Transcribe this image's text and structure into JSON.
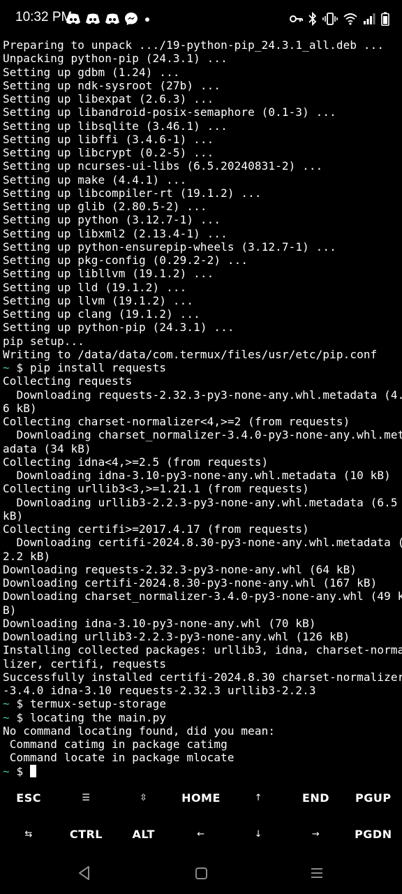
{
  "status_bar": {
    "time": "10:32 PM",
    "notification_icons": [
      "discord-icon",
      "discord-icon",
      "discord-icon",
      "messenger-icon",
      "dot-icon"
    ],
    "system_icons": [
      "key-icon",
      "bluetooth-icon",
      "vibrate-icon",
      "wifi-icon",
      "signal-icon",
      "battery-icon"
    ]
  },
  "terminal": {
    "prompt_symbol": "~",
    "lines": [
      "Preparing to unpack .../19-python-pip_24.3.1_all.deb ...",
      "Unpacking python-pip (24.3.1) ...",
      "Setting up gdbm (1.24) ...",
      "Setting up ndk-sysroot (27b) ...",
      "Setting up libexpat (2.6.3) ...",
      "Setting up libandroid-posix-semaphore (0.1-3) ...",
      "Setting up libsqlite (3.46.1) ...",
      "Setting up libffi (3.4.6-1) ...",
      "Setting up libcrypt (0.2-5) ...",
      "Setting up ncurses-ui-libs (6.5.20240831-2) ...",
      "Setting up make (4.4.1) ...",
      "Setting up libcompiler-rt (19.1.2) ...",
      "Setting up glib (2.80.5-2) ...",
      "Setting up python (3.12.7-1) ...",
      "Setting up libxml2 (2.13.4-1) ...",
      "Setting up python-ensurepip-wheels (3.12.7-1) ...",
      "Setting up pkg-config (0.29.2-2) ...",
      "Setting up libllvm (19.1.2) ...",
      "Setting up lld (19.1.2) ...",
      "Setting up llvm (19.1.2) ...",
      "Setting up clang (19.1.2) ...",
      "Setting up python-pip (24.3.1) ...",
      "pip setup...",
      "Writing to /data/data/com.termux/files/usr/etc/pip.conf",
      " $ pip install requests",
      "Collecting requests",
      "  Downloading requests-2.32.3-py3-none-any.whl.metadata (4.",
      "6 kB)",
      "Collecting charset-normalizer<4,>=2 (from requests)",
      "  Downloading charset_normalizer-3.4.0-py3-none-any.whl.met",
      "adata (34 kB)",
      "Collecting idna<4,>=2.5 (from requests)",
      "  Downloading idna-3.10-py3-none-any.whl.metadata (10 kB)",
      "Collecting urllib3<3,>=1.21.1 (from requests)",
      "  Downloading urllib3-2.2.3-py3-none-any.whl.metadata (6.5",
      "kB)",
      "Collecting certifi>=2017.4.17 (from requests)",
      "  Downloading certifi-2024.8.30-py3-none-any.whl.metadata (",
      "2.2 kB)",
      "Downloading requests-2.32.3-py3-none-any.whl (64 kB)",
      "Downloading certifi-2024.8.30-py3-none-any.whl (167 kB)",
      "Downloading charset_normalizer-3.4.0-py3-none-any.whl (49 k",
      "B)",
      "Downloading idna-3.10-py3-none-any.whl (70 kB)",
      "Downloading urllib3-2.2.3-py3-none-any.whl (126 kB)",
      "Installing collected packages: urllib3, idna, charset-norma",
      "lizer, certifi, requests",
      "Successfully installed certifi-2024.8.30 charset-normalizer",
      "-3.4.0 idna-3.10 requests-2.32.3 urllib3-2.2.3",
      " $ termux-setup-storage",
      " $ locating the main.py",
      "No command locating found, did you mean:",
      " Command catimg in package catimg",
      " Command locate in package mlocate",
      " $ "
    ],
    "prompt_line_indices": [
      24,
      49,
      50,
      54
    ]
  },
  "extra_keys": {
    "row1": [
      {
        "name": "esc",
        "label": "ESC"
      },
      {
        "name": "menu",
        "label": "☰"
      },
      {
        "name": "scroll",
        "label": "⇳"
      },
      {
        "name": "home",
        "label": "HOME"
      },
      {
        "name": "up-arrow",
        "label": "↑"
      },
      {
        "name": "end",
        "label": "END"
      },
      {
        "name": "pgup",
        "label": "PGUP"
      }
    ],
    "row2": [
      {
        "name": "tab",
        "label": "⇆"
      },
      {
        "name": "ctrl",
        "label": "CTRL"
      },
      {
        "name": "alt",
        "label": "ALT"
      },
      {
        "name": "left-arrow",
        "label": "←"
      },
      {
        "name": "down-arrow",
        "label": "↓"
      },
      {
        "name": "right-arrow",
        "label": "→"
      },
      {
        "name": "pgdn",
        "label": "PGDN"
      }
    ]
  },
  "nav_bar": {
    "buttons": [
      "back-icon",
      "home-icon",
      "recents-icon"
    ]
  },
  "colors": {
    "background": "#000000",
    "text": "#ffffff",
    "prompt_tilde": "#4fc3a1",
    "nav_icon": "#8a8a8a"
  }
}
